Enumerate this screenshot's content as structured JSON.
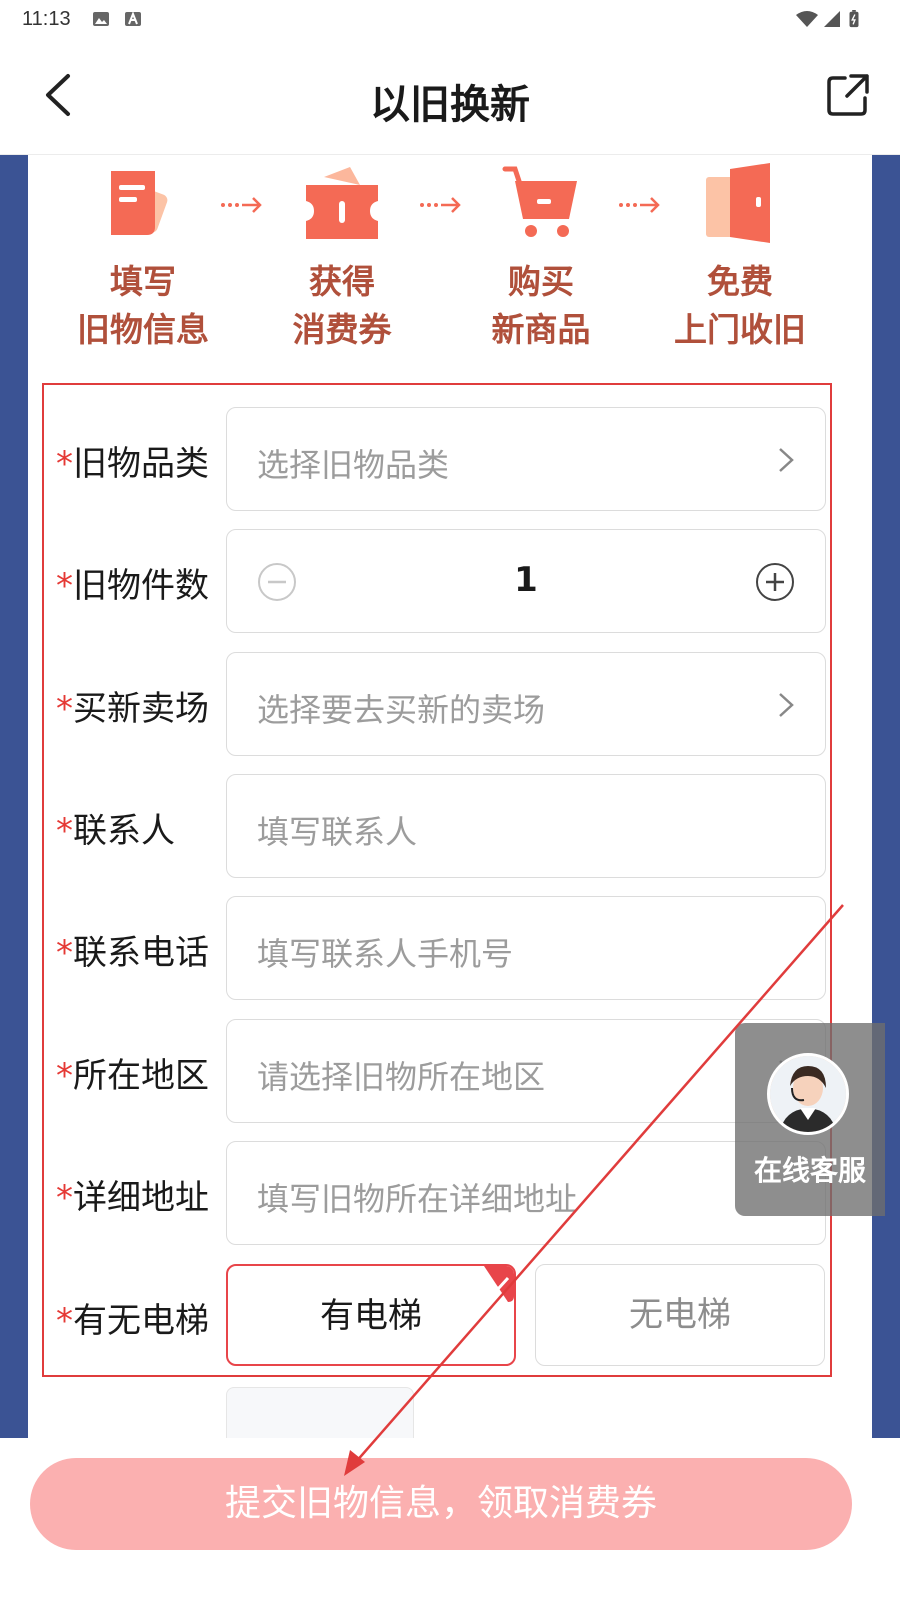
{
  "status_bar": {
    "time": "11:13"
  },
  "nav": {
    "title": "以旧换新"
  },
  "steps": [
    {
      "line1": "填写",
      "line2": "旧物信息",
      "icon": "form-icon"
    },
    {
      "line1": "获得",
      "line2": "消费券",
      "icon": "ticket-icon"
    },
    {
      "line1": "购买",
      "line2": "新商品",
      "icon": "cart-icon"
    },
    {
      "line1": "免费",
      "line2": "上门收旧",
      "icon": "door-icon"
    }
  ],
  "form": {
    "required_mark": "*",
    "category": {
      "label": "旧物品类",
      "placeholder": "选择旧物品类"
    },
    "quantity": {
      "label": "旧物件数",
      "value": "1"
    },
    "store": {
      "label": "买新卖场",
      "placeholder": "选择要去买新的卖场"
    },
    "contact": {
      "label": "联系人",
      "placeholder": "填写联系人"
    },
    "phone": {
      "label": "联系电话",
      "placeholder": "填写联系人手机号"
    },
    "region": {
      "label": "所在地区",
      "placeholder": "请选择旧物所在地区"
    },
    "address": {
      "label": "详细地址",
      "placeholder": "填写旧物所在详细地址"
    },
    "elevator": {
      "label": "有无电梯",
      "option_yes": "有电梯",
      "option_no": "无电梯",
      "selected": "有电梯"
    }
  },
  "submit": {
    "label": "提交旧物信息，领取消费券"
  },
  "customer_service": {
    "label": "在线客服"
  },
  "colors": {
    "accent": "#e8454a",
    "step_text": "#b0503b",
    "side_bg": "#3b5394",
    "submit_bg": "#fbb0b0",
    "annotation": "#e03c3c"
  }
}
